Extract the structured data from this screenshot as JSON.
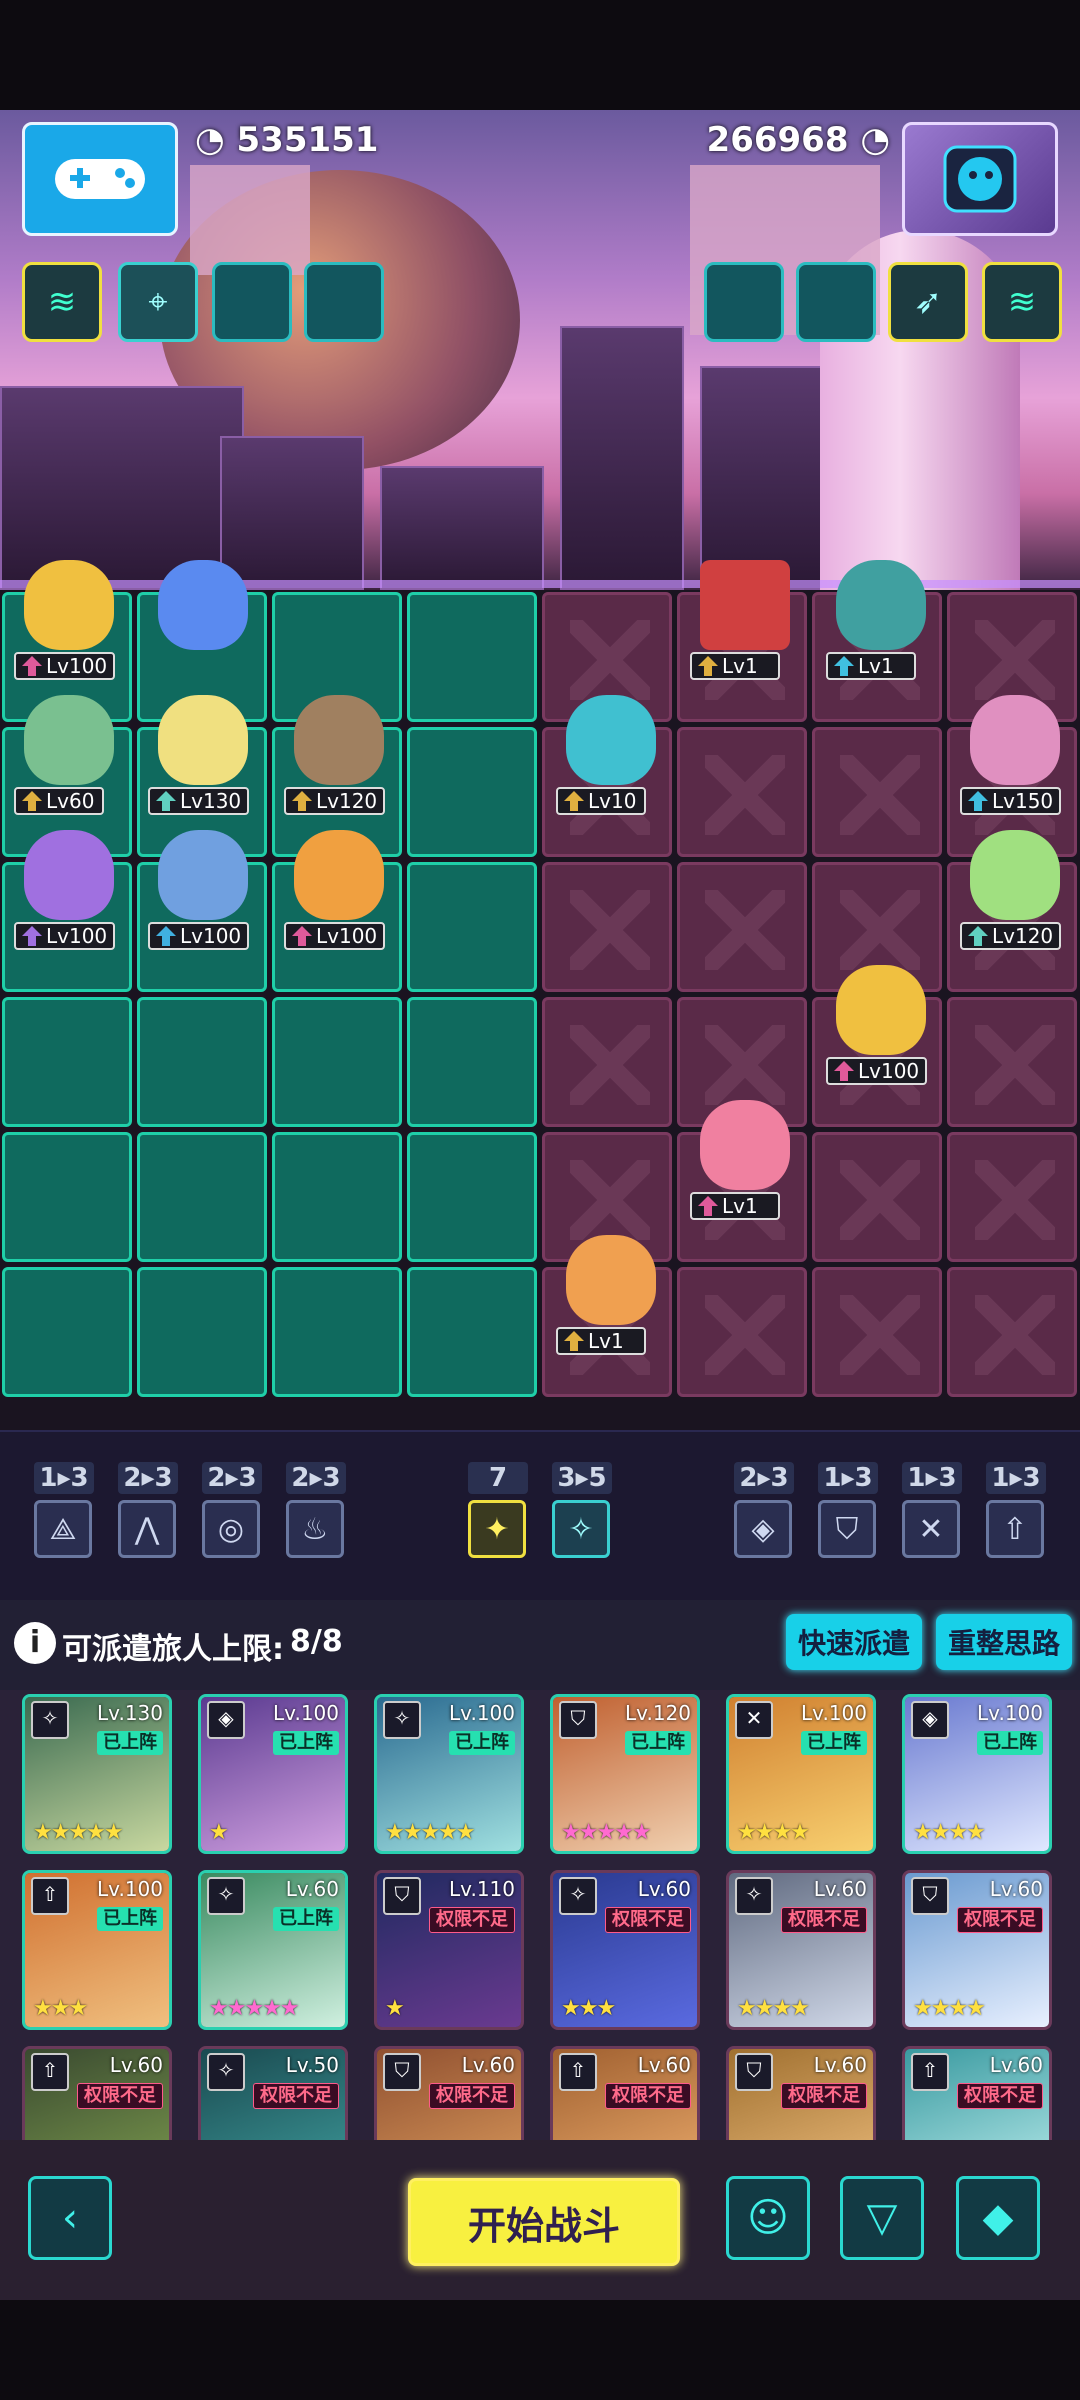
{
  "header": {
    "score_left": "535151",
    "score_right": "266968"
  },
  "icons": {
    "gamepad": "gamepad-icon",
    "avatar": "robot-avatar-icon"
  },
  "board": {
    "allies": [
      {
        "lv": "Lv100"
      },
      {
        "lv": "Lv60"
      },
      {
        "lv": "Lv130"
      },
      {
        "lv": "Lv120"
      },
      {
        "lv": "Lv100"
      },
      {
        "lv": "Lv100"
      },
      {
        "lv": "Lv100"
      }
    ],
    "enemies": [
      {
        "lv": "Lv1"
      },
      {
        "lv": "Lv1"
      },
      {
        "lv": "Lv10"
      },
      {
        "lv": "Lv150"
      },
      {
        "lv": "Lv120"
      },
      {
        "lv": "Lv100"
      },
      {
        "lv": "Lv1"
      },
      {
        "lv": "Lv1"
      }
    ]
  },
  "traits": [
    {
      "count": "1▸3",
      "glyph": "⟁"
    },
    {
      "count": "2▸3",
      "glyph": "⋀"
    },
    {
      "count": "2▸3",
      "glyph": "◎"
    },
    {
      "count": "2▸3",
      "glyph": "♨"
    },
    {
      "count": "7",
      "glyph": "✦"
    },
    {
      "count": "3▸5",
      "glyph": "✧"
    },
    {
      "count": "2▸3",
      "glyph": "◈"
    },
    {
      "count": "1▸3",
      "glyph": "⛉"
    },
    {
      "count": "1▸3",
      "glyph": "✕"
    },
    {
      "count": "1▸3",
      "glyph": "⇧"
    }
  ],
  "roster": {
    "limit_label": "可派遣旅人上限:",
    "limit_value": "8/8",
    "quick_dispatch": "快速派遣",
    "reorganize": "重整思路",
    "status_on": "已上阵",
    "status_locked": "权限不足",
    "cards": [
      {
        "lv": "Lv.130",
        "status": "已上阵",
        "stars": "★★★★★"
      },
      {
        "lv": "Lv.100",
        "status": "已上阵",
        "stars": "★"
      },
      {
        "lv": "Lv.100",
        "status": "已上阵",
        "stars": "★★★★★"
      },
      {
        "lv": "Lv.120",
        "status": "已上阵",
        "stars": "★★★★★"
      },
      {
        "lv": "Lv.100",
        "status": "已上阵",
        "stars": "★★★★"
      },
      {
        "lv": "Lv.100",
        "status": "已上阵",
        "stars": "★★★★"
      },
      {
        "lv": "Lv.100",
        "status": "已上阵",
        "stars": "★★★"
      },
      {
        "lv": "Lv.60",
        "status": "已上阵",
        "stars": "★★★★★"
      },
      {
        "lv": "Lv.110",
        "status": "权限不足",
        "stars": "★"
      },
      {
        "lv": "Lv.60",
        "status": "权限不足",
        "stars": "★★★"
      },
      {
        "lv": "Lv.60",
        "status": "权限不足",
        "stars": "★★★★"
      },
      {
        "lv": "Lv.60",
        "status": "权限不足",
        "stars": "★★★★"
      },
      {
        "lv": "Lv.60",
        "status": "权限不足",
        "stars": ""
      },
      {
        "lv": "Lv.50",
        "status": "权限不足",
        "stars": ""
      },
      {
        "lv": "Lv.60",
        "status": "权限不足",
        "stars": ""
      },
      {
        "lv": "Lv.60",
        "status": "权限不足",
        "stars": ""
      },
      {
        "lv": "Lv.60",
        "status": "权限不足",
        "stars": ""
      },
      {
        "lv": "Lv.60",
        "status": "权限不足",
        "stars": ""
      }
    ]
  },
  "bottom": {
    "start_battle": "开始战斗"
  }
}
